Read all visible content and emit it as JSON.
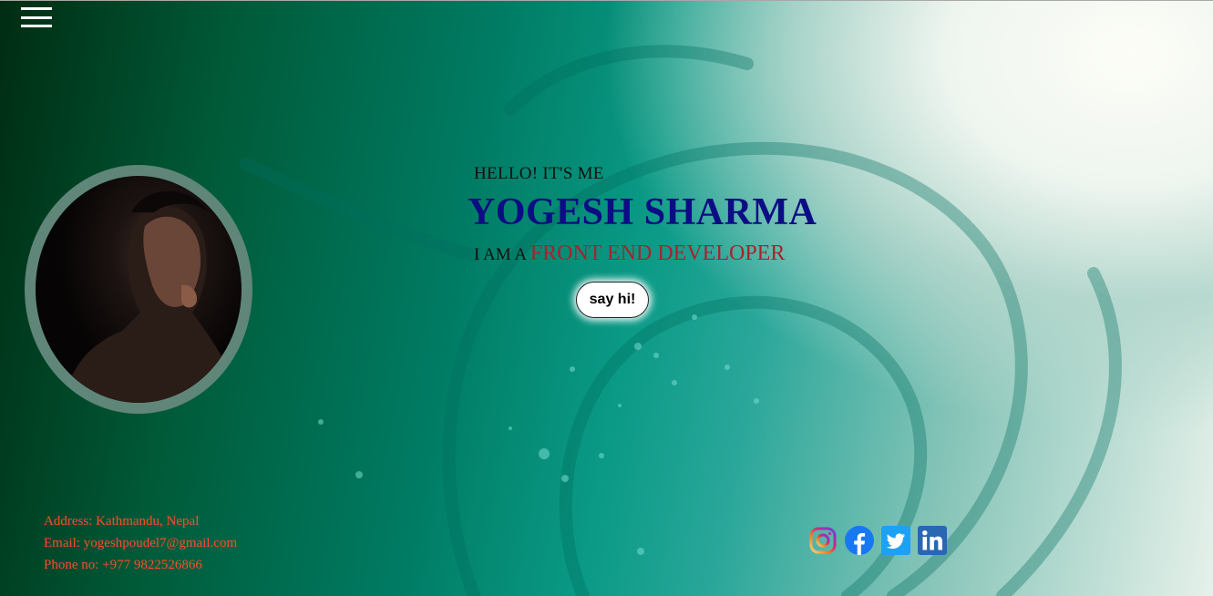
{
  "hero": {
    "greeting": "HELLO! IT'S ME",
    "name": "YOGESH SHARMA",
    "role_prefix": "I AM A",
    "role": "FRONT END DEVELOPER",
    "cta_label": "say hi!"
  },
  "contact": {
    "address": "Address: Kathmandu, Nepal",
    "email": "Email: yogeshpoudel7@gmail.com",
    "phone": "Phone no: +977 9822526866"
  },
  "social": [
    {
      "name": "instagram-icon"
    },
    {
      "name": "facebook-icon"
    },
    {
      "name": "twitter-icon"
    },
    {
      "name": "linkedin-icon"
    }
  ],
  "colors": {
    "name": "#0c0c84",
    "role": "#a8232b",
    "contact": "#ff4c2b",
    "ring": "#5f8679"
  }
}
